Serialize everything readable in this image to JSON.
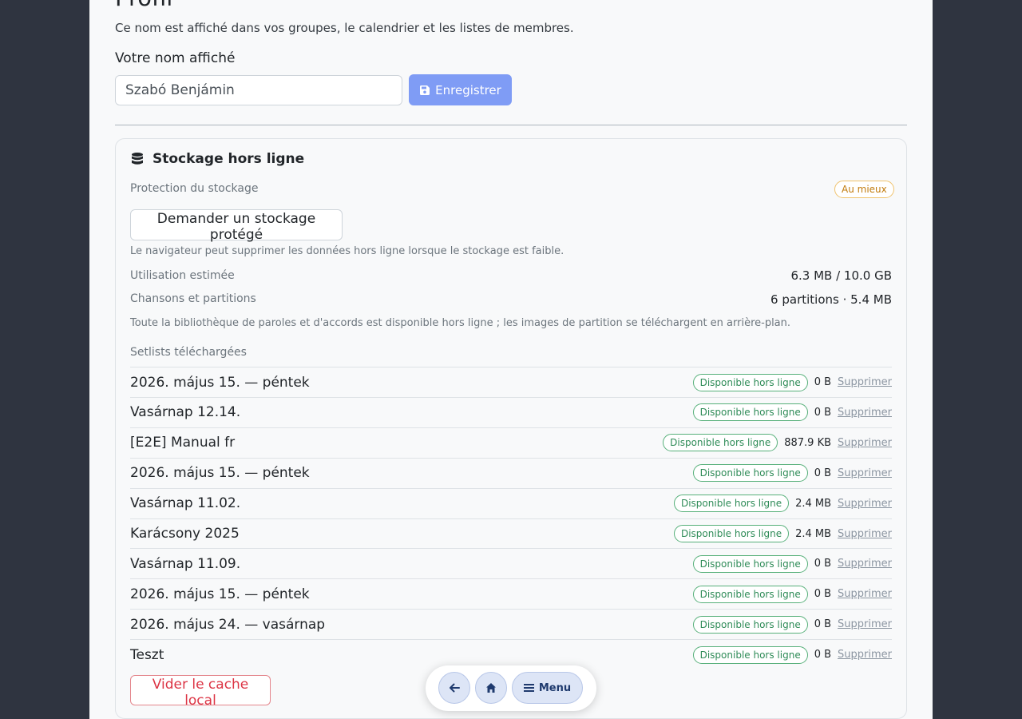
{
  "header": {
    "title": "Profil",
    "subtitle": "Ce nom est affiché dans vos groupes, le calendrier et les listes de membres."
  },
  "profile": {
    "name_label": "Votre nom affiché",
    "name_value": "Szabó Benjámin",
    "save_label": "Enregistrer",
    "save_icon": "save-icon"
  },
  "storage": {
    "title": "Stockage hors ligne",
    "title_icon": "database-icon",
    "protection_label": "Protection du stockage",
    "protection_badge": "Au mieux",
    "request_button": "Demander un stockage protégé",
    "protection_note": "Le navigateur peut supprimer les données hors ligne lorsque le stockage est faible.",
    "usage_label": "Utilisation estimée",
    "usage_value": "6.3 MB / 10.0 GB",
    "songs_label": "Chansons et partitions",
    "songs_value": "6 partitions · 5.4 MB",
    "library_note": "Toute la bibliothèque de paroles et d'accords est disponible hors ligne ; les images de partition se téléchargent en arrière-plan.",
    "setlists_label": "Setlists téléchargées",
    "setlists": [
      {
        "name": "2026. május 15. — péntek",
        "status": "Disponible hors ligne",
        "size": "0 B",
        "action": "Supprimer"
      },
      {
        "name": "Vasárnap 12.14.",
        "status": "Disponible hors ligne",
        "size": "0 B",
        "action": "Supprimer"
      },
      {
        "name": "[E2E] Manual fr",
        "status": "Disponible hors ligne",
        "size": "887.9 KB",
        "action": "Supprimer"
      },
      {
        "name": "2026. május 15. — péntek",
        "status": "Disponible hors ligne",
        "size": "0 B",
        "action": "Supprimer"
      },
      {
        "name": "Vasárnap 11.02.",
        "status": "Disponible hors ligne",
        "size": "2.4 MB",
        "action": "Supprimer"
      },
      {
        "name": "Karácsony 2025",
        "status": "Disponible hors ligne",
        "size": "2.4 MB",
        "action": "Supprimer"
      },
      {
        "name": "Vasárnap 11.09.",
        "status": "Disponible hors ligne",
        "size": "0 B",
        "action": "Supprimer"
      },
      {
        "name": "2026. május 15. — péntek",
        "status": "Disponible hors ligne",
        "size": "0 B",
        "action": "Supprimer"
      },
      {
        "name": "2026. május 24. — vasárnap",
        "status": "Disponible hors ligne",
        "size": "0 B",
        "action": "Supprimer"
      },
      {
        "name": "Teszt",
        "status": "Disponible hors ligne",
        "size": "0 B",
        "action": "Supprimer"
      }
    ],
    "clear_button": "Vider le cache local"
  },
  "dock": {
    "back_icon": "arrow-left-icon",
    "home_icon": "home-icon",
    "menu_label": "Menu",
    "menu_icon": "menu-icon"
  },
  "colors": {
    "background": "#2f3440",
    "panel": "#f8f9fa",
    "primary_button": "#7f9cf5",
    "success": "#2e8b57",
    "warning": "#c27c0e",
    "danger": "#dc3545"
  }
}
